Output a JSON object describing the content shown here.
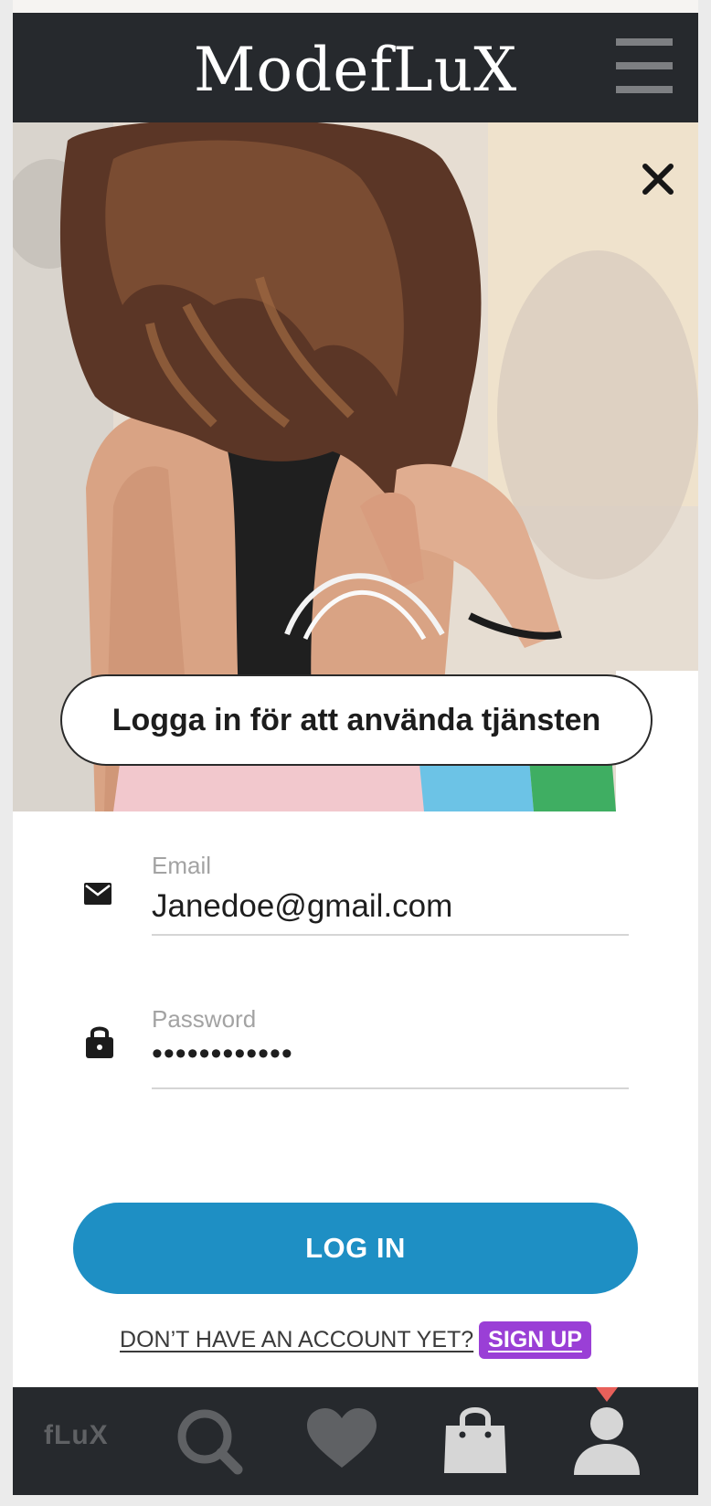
{
  "header": {
    "logo": "ModefLuX",
    "menu_icon": "hamburger-menu-icon"
  },
  "hero": {
    "close_icon": "close-icon",
    "banner_text": "Logga in för att använda tjänsten"
  },
  "form": {
    "email": {
      "label": "Email",
      "value": "Janedoe@gmail.com",
      "icon": "envelope-icon"
    },
    "password": {
      "label": "Password",
      "value": "••••••••••••",
      "icon": "lock-icon"
    },
    "login_button": "LOG IN",
    "signup_question": "DON’T HAVE AN ACCOUNT YET?",
    "signup_link": "SIGN UP"
  },
  "bottom_nav": {
    "brand": "fLuX",
    "items": [
      {
        "icon": "search-icon"
      },
      {
        "icon": "heart-icon"
      },
      {
        "icon": "shopping-bag-icon"
      },
      {
        "icon": "profile-icon",
        "active": true
      }
    ]
  },
  "colors": {
    "header_bg": "#26292d",
    "primary_button": "#1e8fc4",
    "signup_accent": "#9a3fd6",
    "active_indicator": "#e8605a",
    "inactive_nav_icon": "#5f6164",
    "active_nav_icon": "#d6d6d6"
  }
}
